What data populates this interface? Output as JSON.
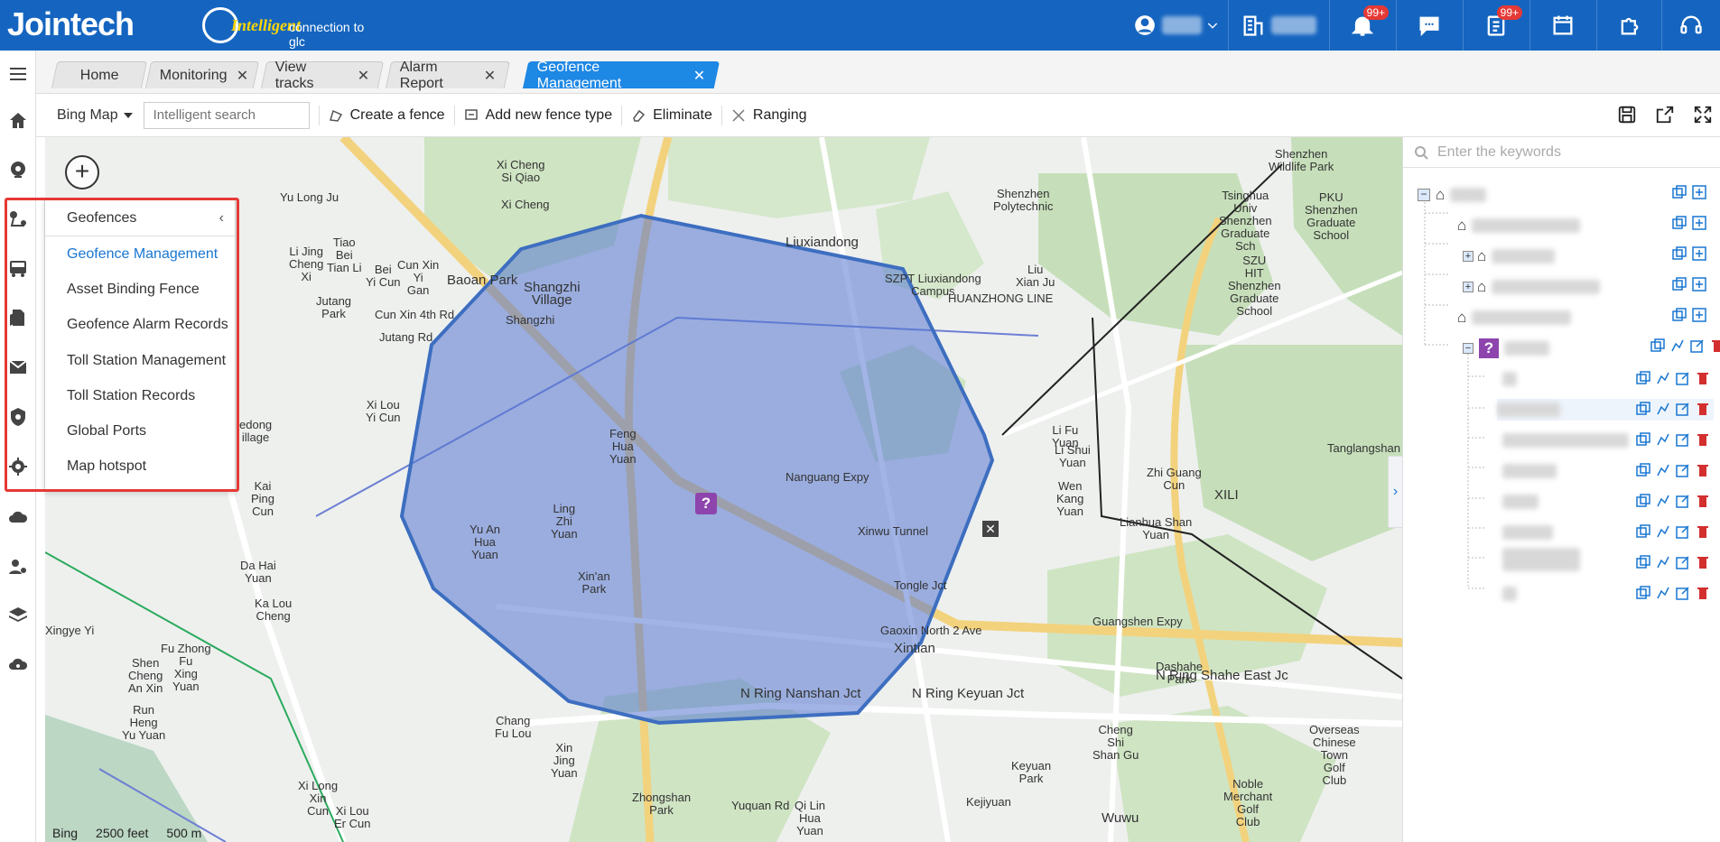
{
  "brand": {
    "logo_text": "Jointech",
    "tagline_bold": "Intelligent",
    "tagline_rest": "connection to glc"
  },
  "topbar": {
    "notifications_badge": "99+",
    "tasks_badge": "99+",
    "icons": [
      "user-icon",
      "building-icon",
      "bell-icon",
      "chat-icon",
      "clipboard-icon",
      "calendar-icon",
      "puzzle-icon",
      "headset-icon"
    ]
  },
  "left_nav": [
    "menu-icon",
    "home-icon",
    "monitor-icon",
    "route-icon",
    "vehicle-icon",
    "document-icon",
    "mail-icon",
    "shield-icon",
    "settings-icon",
    "cloud-icon",
    "user-gear-icon",
    "layers-icon",
    "cloud-settings-icon"
  ],
  "tabs": [
    {
      "label": "Home",
      "closable": false
    },
    {
      "label": "Monitoring",
      "closable": true
    },
    {
      "label": "View tracks",
      "closable": true
    },
    {
      "label": "Alarm Report",
      "closable": true
    },
    {
      "label": "Geofence Management",
      "closable": true,
      "active": true
    }
  ],
  "tab_close_glyph": "✕",
  "toolbar": {
    "map_type": "Bing Map",
    "search_placeholder": "Intelligent search",
    "create_fence": "Create a fence",
    "add_fence_type": "Add new fence type",
    "eliminate": "Eliminate",
    "ranging": "Ranging"
  },
  "geofence_menu": {
    "title": "Geofences",
    "items": [
      "Geofence Management",
      "Asset Binding Fence",
      "Geofence Alarm Records",
      "Toll Station Management",
      "Toll Station Records",
      "Global Ports",
      "Map hotspot"
    ],
    "active_item": "Geofence Management"
  },
  "right_panel": {
    "search_placeholder": "Enter the keywords"
  },
  "map": {
    "attribution": "Bing",
    "scale_feet": "2500 feet",
    "scale_m": "500 m",
    "labels": [
      "Xi Cheng\nSi Qiao",
      "Xi Cheng",
      "Baoan Park",
      "Liuxiandong",
      "Shangzhi\nVillage",
      "HUANZHONG LINE",
      "Shenzhen\nPolytechnic",
      "SZPT Liuxiandong\nCampus",
      "Liu\nXian Ju",
      "Tsinghua\nUniv\nShenzhen\nGraduate\nSch",
      "PKU\nShenzhen\nGraduate\nSchool",
      "Shenzhen\nWildlife Park",
      "SZU\nHIT\nShenzhen\nGraduate\nSchool",
      "Yu Long Ju",
      "Li Jing\nCheng\nXi",
      "Tiao\nBei\nTian Li",
      "Jutang\nPark",
      "Cun Xin\nYi\nGan",
      "Bei\nYi Cun",
      "Xi Lou\nYi Cun",
      "Cun Xin 4th Rd",
      "Feng\nHua\nYuan",
      "Ling\nZhi\nYuan",
      "Yu An\nHua\nYuan",
      "Xin'an\nPark",
      "Nanguang Expy",
      "Xinwu Tunnel",
      "Tongle Jct",
      "Xintian",
      "Gaoxin North 2 Ave",
      "Li Fu\nYuan",
      "Li Shui\nYuan",
      "Wen\nKang\nYuan",
      "Zhi Guang\nCun",
      "XILI",
      "Lianhua Shan\nYuan",
      "Tanglangshan",
      "Guangshen Expy",
      "N Ring Nanshan Jct",
      "N Ring Keyuan Jct",
      "N Ring Shahe East Jc",
      "Cheng\nShi\nShan Gu",
      "Keyuan\nPark",
      "Dashahe\nPark",
      "Wuwu",
      "Noble\nMerchant\nGolf\nClub",
      "Overseas\nChinese\nTown\nGolf\nClub",
      "Zhongshan\nPark",
      "Chang\nFu Lou",
      "Kai\nPing\nCun",
      "Da Hai\nYuan",
      "Ka Lou\nCheng",
      "Fu Zhong\nFu\nXing\nYuan",
      "Shen\nCheng\nAn Xin",
      "Run\nHeng\nYu Yuan",
      "Xingye Yi",
      "Xin\nJing\nYuan",
      "Xi Long\nXin\nCun",
      "Xi Lou\nEr Cun",
      "edong\nillage",
      "Jutang Rd",
      "Yuquan Rd",
      "Qi Lin\nHua\nYuan",
      "Kejiyuan",
      "Shangzhi"
    ]
  }
}
